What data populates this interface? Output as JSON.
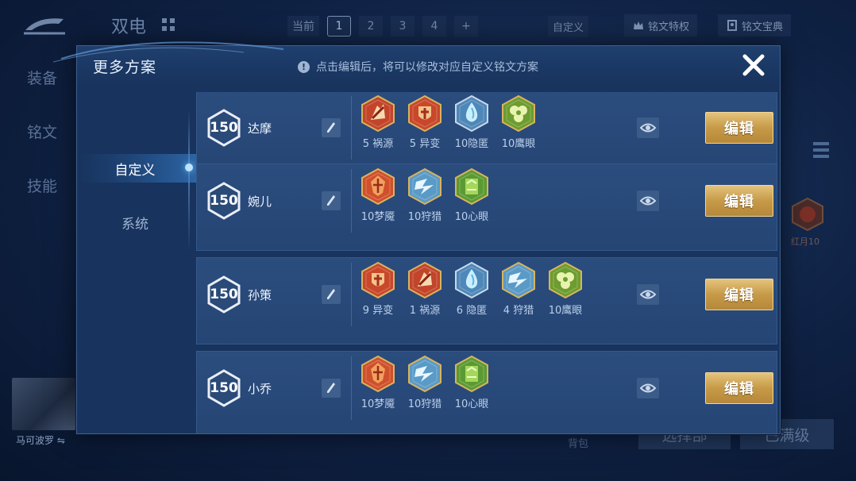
{
  "background": {
    "title": "双电",
    "tabs": [
      "当前",
      "1",
      "2",
      "3",
      "4",
      "+"
    ],
    "custom_tab": "自定义",
    "buttons": {
      "rune_privilege": "铭文特权",
      "rune_guide": "铭文宝典"
    },
    "left_menu": [
      "装备",
      "铭文",
      "技能"
    ],
    "side_rune_label": "红月10",
    "hero_name": "马可波罗",
    "swap_glyph": "⇋",
    "bottom_buttons": {
      "select": "选择部",
      "max_level": "已满级"
    },
    "bag": "背包"
  },
  "modal": {
    "title": "更多方案",
    "hint": "点击编辑后，将可以修改对应自定义铭文方案",
    "sidebar": [
      {
        "label": "自定义",
        "active": true
      },
      {
        "label": "系统",
        "active": false
      }
    ],
    "plans": [
      {
        "level": "150",
        "name": "达摩",
        "edit_label": "编辑",
        "runes": [
          {
            "label": "5 祸源",
            "kind": "red-claw"
          },
          {
            "label": "5 异变",
            "kind": "red-shield"
          },
          {
            "label": "10隐匿",
            "kind": "blue-drop"
          },
          {
            "label": "10鹰眼",
            "kind": "green-clover"
          }
        ]
      },
      {
        "level": "150",
        "name": "婉儿",
        "edit_label": "编辑",
        "runes": [
          {
            "label": "10梦魇",
            "kind": "red-crest"
          },
          {
            "label": "10狩猎",
            "kind": "blue-bolt"
          },
          {
            "label": "10心眼",
            "kind": "green-gem"
          }
        ]
      },
      {
        "level": "150",
        "name": "孙策",
        "edit_label": "编辑",
        "runes": [
          {
            "label": "9 异变",
            "kind": "red-shield"
          },
          {
            "label": "1 祸源",
            "kind": "red-claw"
          },
          {
            "label": "6 隐匿",
            "kind": "blue-drop"
          },
          {
            "label": "4 狩猎",
            "kind": "blue-bolt"
          },
          {
            "label": "10鹰眼",
            "kind": "green-clover"
          }
        ]
      },
      {
        "level": "150",
        "name": "小乔",
        "edit_label": "编辑",
        "runes": [
          {
            "label": "10梦魇",
            "kind": "red-crest"
          },
          {
            "label": "10狩猎",
            "kind": "blue-bolt"
          },
          {
            "label": "10心眼",
            "kind": "green-gem"
          }
        ]
      }
    ]
  },
  "colors": {
    "gold_button": "#c69a48",
    "panel": "#18335d",
    "card": "#2b4d7e",
    "rune_red": "#d9502a",
    "rune_blue": "#8fd3f0",
    "rune_green": "#7fb33a"
  }
}
